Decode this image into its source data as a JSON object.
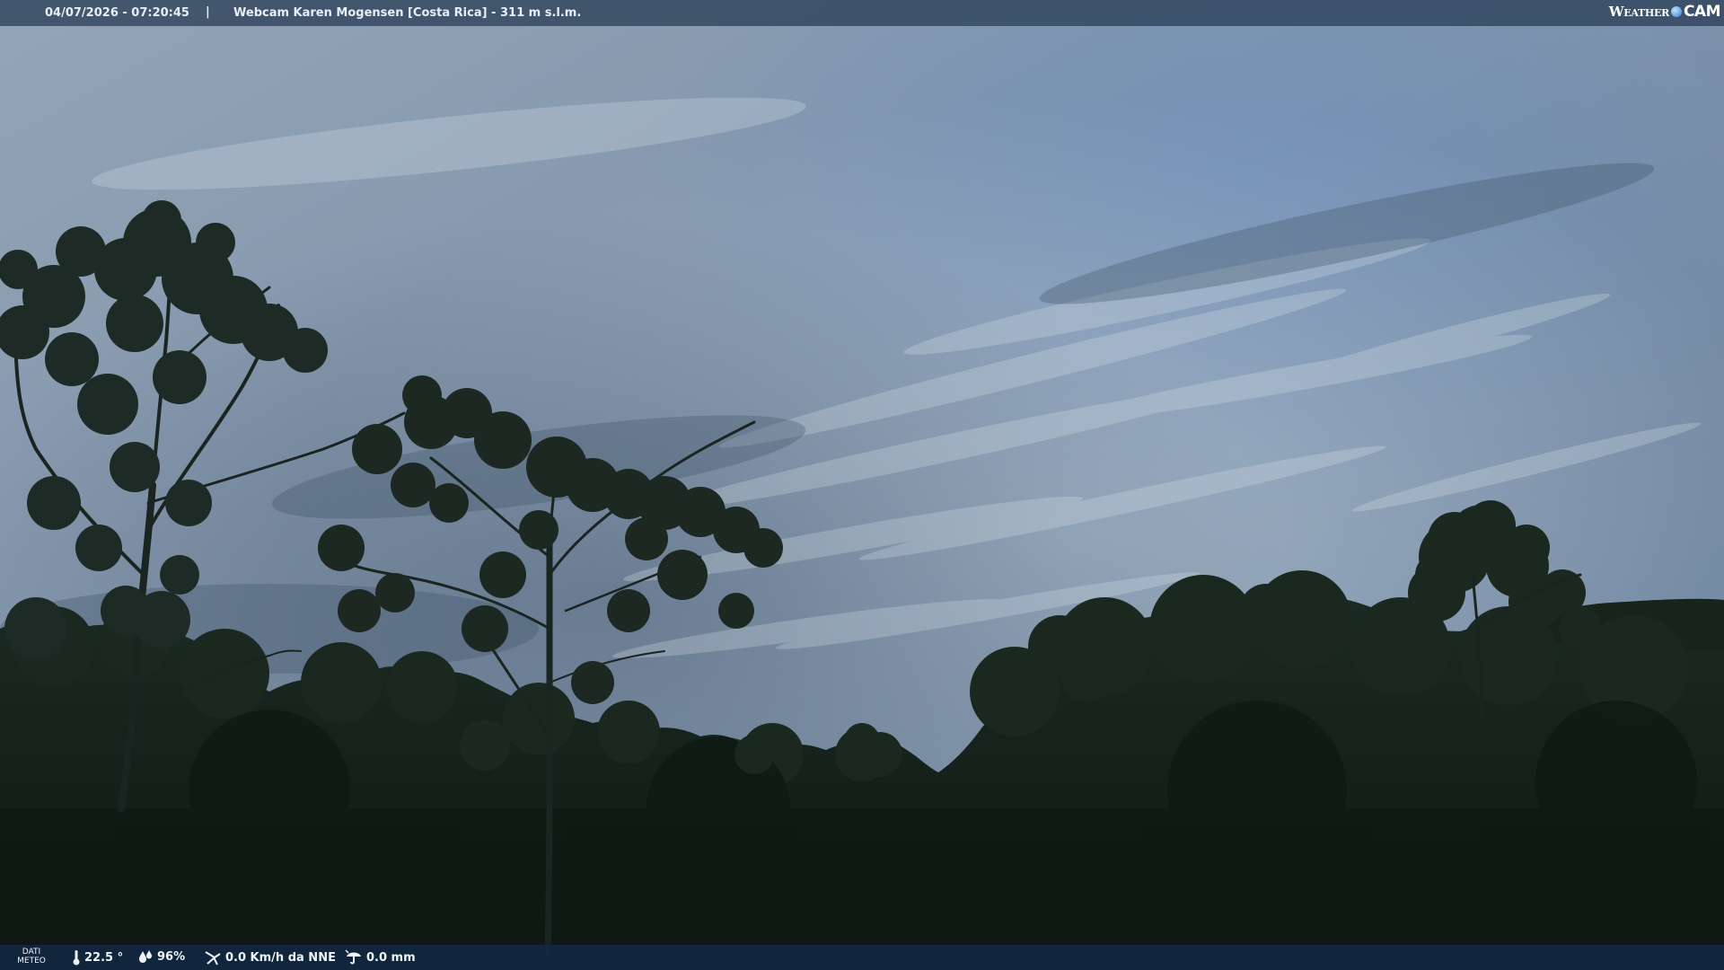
{
  "header": {
    "datetime": "04/07/2026 - 07:20:45",
    "separator": "|",
    "title": "Webcam Karen Mogensen [Costa Rica]  - 311 m s.l.m."
  },
  "brand": {
    "part1": "Weather",
    "part2": "CAM"
  },
  "footer": {
    "label_line1": "DATI",
    "label_line2": "METEO",
    "temperature": "22.5 °",
    "humidity": "96%",
    "wind": "0.0 Km/h da NNE",
    "rain": "0.0 mm"
  },
  "icons": {
    "temperature": "thermometer-icon",
    "humidity": "humidity-drops-icon",
    "wind": "wind-icon",
    "rain": "rain-gauge-icon",
    "brand": "weathercam-logo-dot"
  },
  "colors": {
    "sky_top": "#8e9fb1",
    "sky_mid": "#7d93ad",
    "vegetation": "#141e18",
    "topbar": "#2c4058",
    "bottombar": "#122a46"
  }
}
